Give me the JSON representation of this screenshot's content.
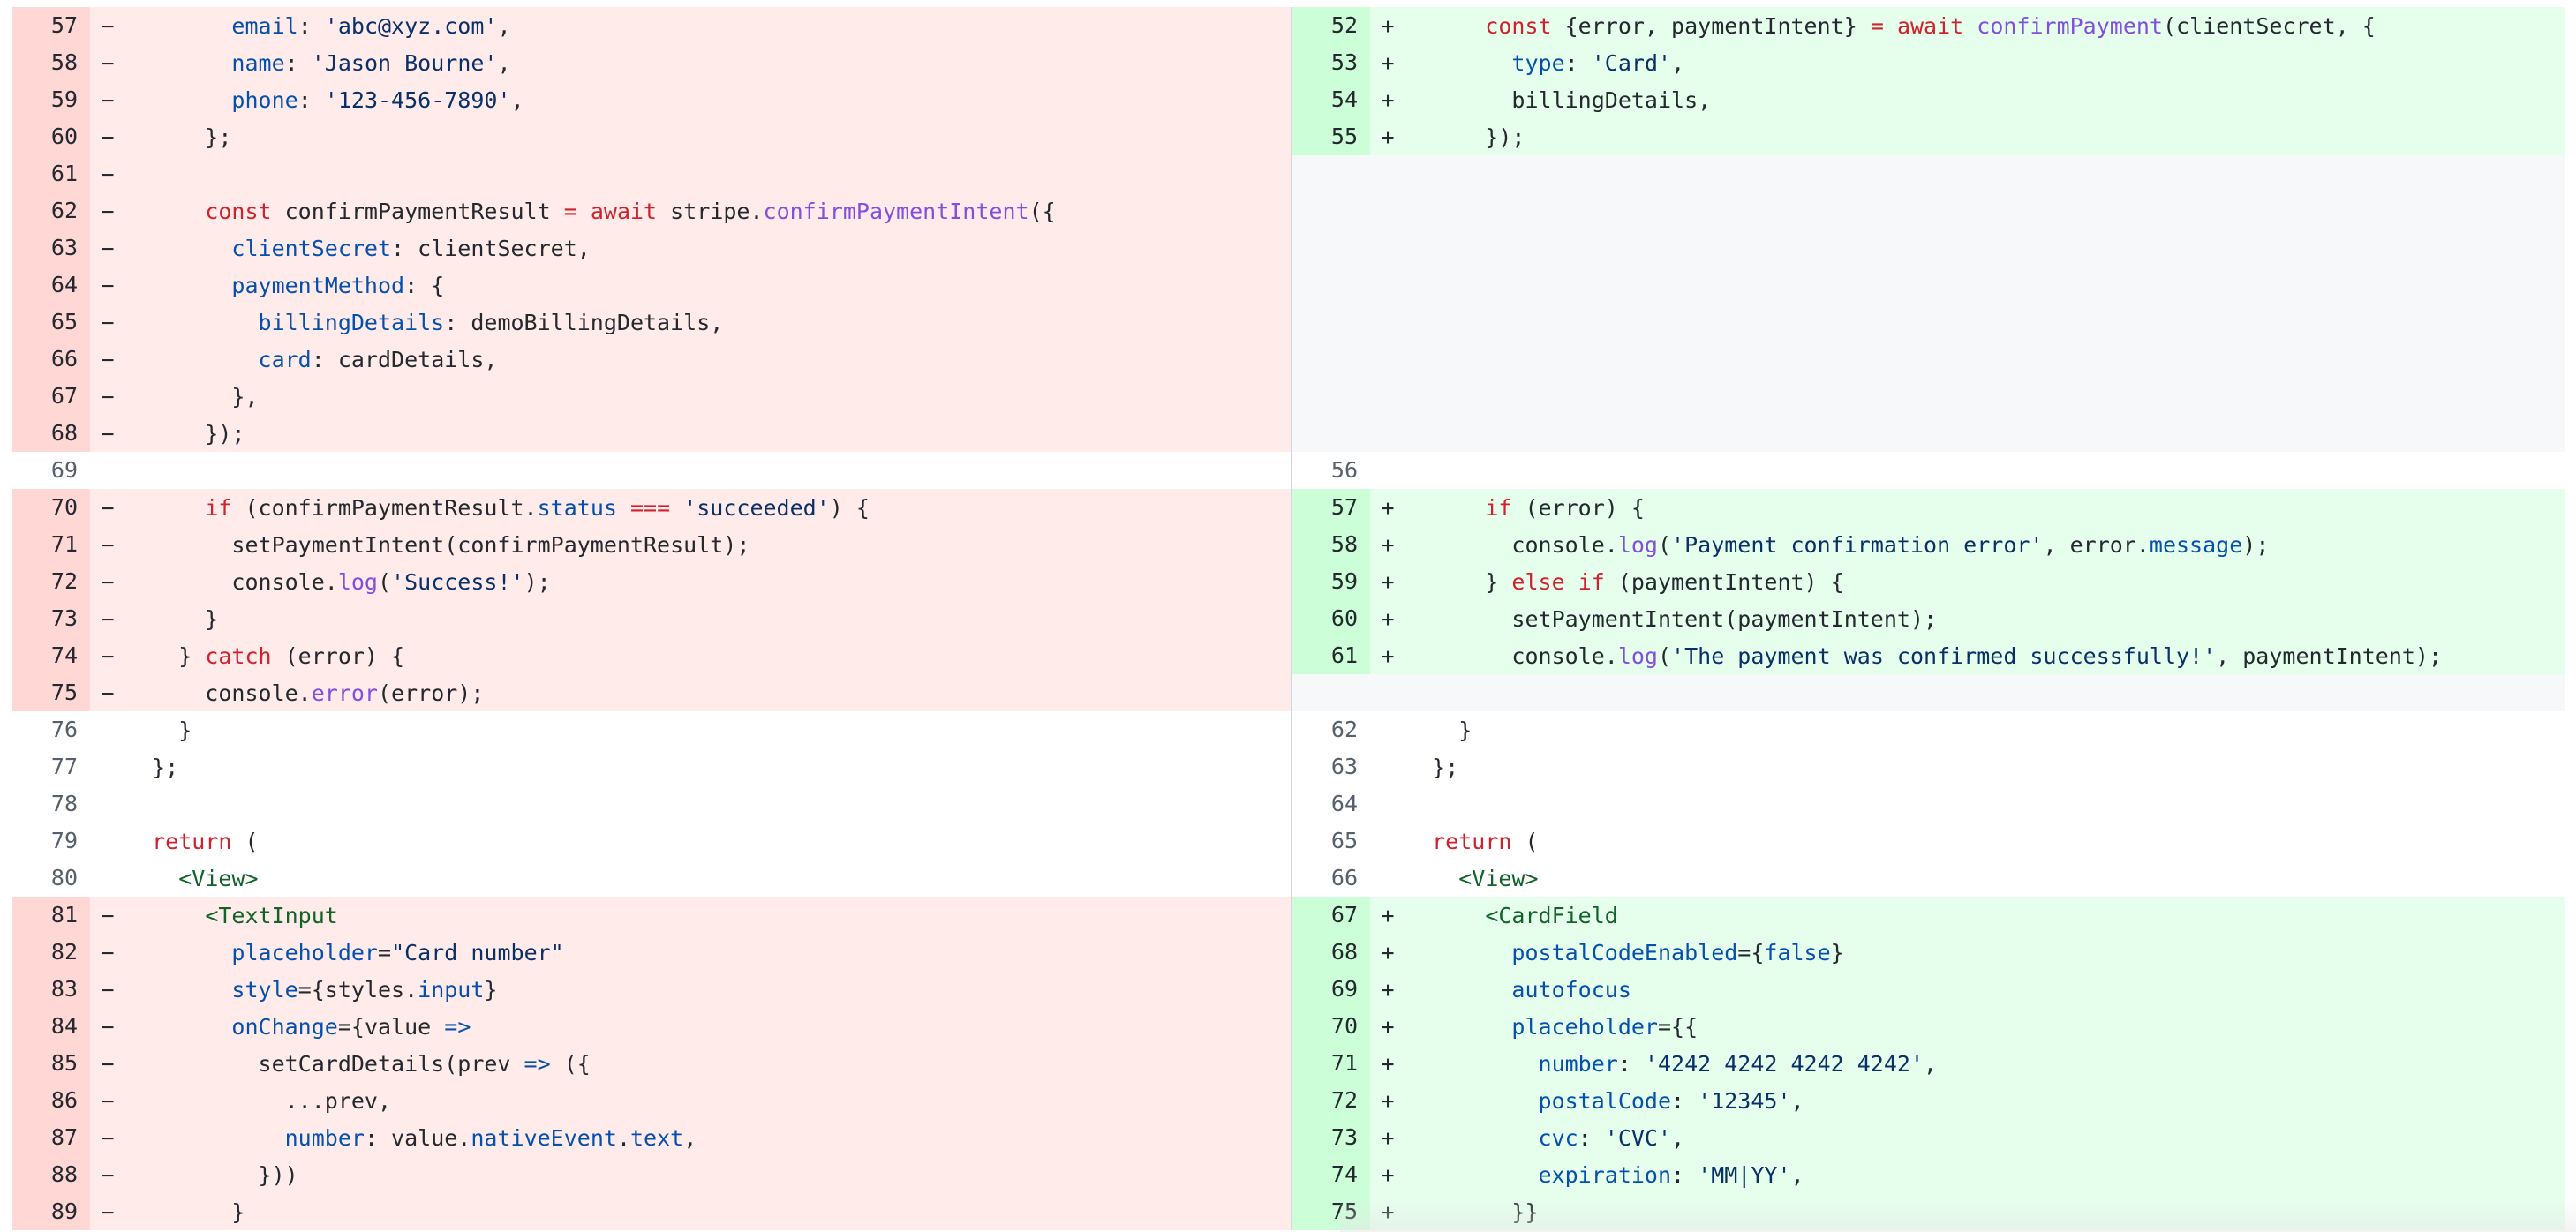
{
  "colors": {
    "del_num_bg": "#ffd7d5",
    "del_code_bg": "#ffebe9",
    "add_num_bg": "#ccffd8",
    "add_code_bg": "#e6ffec",
    "empty_bg": "#f6f8fa",
    "keyword": "#cf222e",
    "property": "#0550ae",
    "string": "#0a3069",
    "function": "#8250df",
    "tag": "#116329"
  },
  "left": [
    {
      "type": "del",
      "num": "57",
      "marker": "−",
      "tokens": [
        [
          "p",
          "        "
        ],
        [
          "prop",
          "email"
        ],
        [
          "p",
          ": "
        ],
        [
          "str",
          "'abc@xyz.com'"
        ],
        [
          "p",
          ","
        ]
      ]
    },
    {
      "type": "del",
      "num": "58",
      "marker": "−",
      "tokens": [
        [
          "p",
          "        "
        ],
        [
          "prop",
          "name"
        ],
        [
          "p",
          ": "
        ],
        [
          "str",
          "'Jason Bourne'"
        ],
        [
          "p",
          ","
        ]
      ]
    },
    {
      "type": "del",
      "num": "59",
      "marker": "−",
      "tokens": [
        [
          "p",
          "        "
        ],
        [
          "prop",
          "phone"
        ],
        [
          "p",
          ": "
        ],
        [
          "str",
          "'123-456-7890'"
        ],
        [
          "p",
          ","
        ]
      ]
    },
    {
      "type": "del",
      "num": "60",
      "marker": "−",
      "tokens": [
        [
          "p",
          "      };"
        ]
      ]
    },
    {
      "type": "del",
      "num": "61",
      "marker": "−",
      "tokens": []
    },
    {
      "type": "del",
      "num": "62",
      "marker": "−",
      "tokens": [
        [
          "p",
          "      "
        ],
        [
          "kw",
          "const"
        ],
        [
          "p",
          " confirmPaymentResult "
        ],
        [
          "kw",
          "="
        ],
        [
          "p",
          " "
        ],
        [
          "kw",
          "await"
        ],
        [
          "p",
          " stripe."
        ],
        [
          "fn",
          "confirmPaymentIntent"
        ],
        [
          "p",
          "({"
        ]
      ]
    },
    {
      "type": "del",
      "num": "63",
      "marker": "−",
      "tokens": [
        [
          "p",
          "        "
        ],
        [
          "prop",
          "clientSecret"
        ],
        [
          "p",
          ": clientSecret,"
        ]
      ]
    },
    {
      "type": "del",
      "num": "64",
      "marker": "−",
      "tokens": [
        [
          "p",
          "        "
        ],
        [
          "prop",
          "paymentMethod"
        ],
        [
          "p",
          ": {"
        ]
      ]
    },
    {
      "type": "del",
      "num": "65",
      "marker": "−",
      "tokens": [
        [
          "p",
          "          "
        ],
        [
          "prop",
          "billingDetails"
        ],
        [
          "p",
          ": demoBillingDetails,"
        ]
      ]
    },
    {
      "type": "del",
      "num": "66",
      "marker": "−",
      "tokens": [
        [
          "p",
          "          "
        ],
        [
          "prop",
          "card"
        ],
        [
          "p",
          ": cardDetails,"
        ]
      ]
    },
    {
      "type": "del",
      "num": "67",
      "marker": "−",
      "tokens": [
        [
          "p",
          "        },"
        ]
      ]
    },
    {
      "type": "del",
      "num": "68",
      "marker": "−",
      "tokens": [
        [
          "p",
          "      });"
        ]
      ]
    },
    {
      "type": "ctx",
      "num": "69",
      "marker": "",
      "tokens": []
    },
    {
      "type": "del",
      "num": "70",
      "marker": "−",
      "tokens": [
        [
          "p",
          "      "
        ],
        [
          "kw",
          "if"
        ],
        [
          "p",
          " (confirmPaymentResult."
        ],
        [
          "prop",
          "status"
        ],
        [
          "p",
          " "
        ],
        [
          "kw",
          "==="
        ],
        [
          "p",
          " "
        ],
        [
          "str",
          "'succeeded'"
        ],
        [
          "p",
          ") {"
        ]
      ]
    },
    {
      "type": "del",
      "num": "71",
      "marker": "−",
      "tokens": [
        [
          "p",
          "        setPaymentIntent(confirmPaymentResult);"
        ]
      ]
    },
    {
      "type": "del",
      "num": "72",
      "marker": "−",
      "tokens": [
        [
          "p",
          "        console."
        ],
        [
          "fn",
          "log"
        ],
        [
          "p",
          "("
        ],
        [
          "str",
          "'Success!'"
        ],
        [
          "p",
          ");"
        ]
      ]
    },
    {
      "type": "del",
      "num": "73",
      "marker": "−",
      "tokens": [
        [
          "p",
          "      }"
        ]
      ]
    },
    {
      "type": "del",
      "num": "74",
      "marker": "−",
      "tokens": [
        [
          "p",
          "    } "
        ],
        [
          "kw",
          "catch"
        ],
        [
          "p",
          " (error) {"
        ]
      ]
    },
    {
      "type": "del",
      "num": "75",
      "marker": "−",
      "tokens": [
        [
          "p",
          "      console."
        ],
        [
          "fn",
          "error"
        ],
        [
          "p",
          "(error);"
        ]
      ]
    },
    {
      "type": "ctx",
      "num": "76",
      "marker": "",
      "tokens": [
        [
          "p",
          "    }"
        ]
      ]
    },
    {
      "type": "ctx",
      "num": "77",
      "marker": "",
      "tokens": [
        [
          "p",
          "  };"
        ]
      ]
    },
    {
      "type": "ctx",
      "num": "78",
      "marker": "",
      "tokens": []
    },
    {
      "type": "ctx",
      "num": "79",
      "marker": "",
      "tokens": [
        [
          "p",
          "  "
        ],
        [
          "kw",
          "return"
        ],
        [
          "p",
          " ("
        ]
      ]
    },
    {
      "type": "ctx",
      "num": "80",
      "marker": "",
      "tokens": [
        [
          "p",
          "    "
        ],
        [
          "tag",
          "<View>"
        ]
      ]
    },
    {
      "type": "del",
      "num": "81",
      "marker": "−",
      "tokens": [
        [
          "p",
          "      "
        ],
        [
          "tag",
          "<TextInput"
        ]
      ]
    },
    {
      "type": "del",
      "num": "82",
      "marker": "−",
      "tokens": [
        [
          "p",
          "        "
        ],
        [
          "prop",
          "placeholder"
        ],
        [
          "p",
          "="
        ],
        [
          "str",
          "\"Card number\""
        ]
      ]
    },
    {
      "type": "del",
      "num": "83",
      "marker": "−",
      "tokens": [
        [
          "p",
          "        "
        ],
        [
          "prop",
          "style"
        ],
        [
          "p",
          "={styles."
        ],
        [
          "prop",
          "input"
        ],
        [
          "p",
          "}"
        ]
      ]
    },
    {
      "type": "del",
      "num": "84",
      "marker": "−",
      "tokens": [
        [
          "p",
          "        "
        ],
        [
          "prop",
          "onChange"
        ],
        [
          "p",
          "={value "
        ],
        [
          "prop",
          "=>"
        ]
      ]
    },
    {
      "type": "del",
      "num": "85",
      "marker": "−",
      "tokens": [
        [
          "p",
          "          setCardDetails(prev "
        ],
        [
          "prop",
          "=>"
        ],
        [
          "p",
          " ({"
        ]
      ]
    },
    {
      "type": "del",
      "num": "86",
      "marker": "−",
      "tokens": [
        [
          "p",
          "            ...prev,"
        ]
      ]
    },
    {
      "type": "del",
      "num": "87",
      "marker": "−",
      "tokens": [
        [
          "p",
          "            "
        ],
        [
          "prop",
          "number"
        ],
        [
          "p",
          ": value."
        ],
        [
          "prop",
          "nativeEvent"
        ],
        [
          "p",
          "."
        ],
        [
          "prop",
          "text"
        ],
        [
          "p",
          ","
        ]
      ]
    },
    {
      "type": "del",
      "num": "88",
      "marker": "−",
      "tokens": [
        [
          "p",
          "          }))"
        ]
      ]
    },
    {
      "type": "del",
      "num": "89",
      "marker": "−",
      "tokens": [
        [
          "p",
          "        }"
        ]
      ]
    }
  ],
  "right": [
    {
      "type": "add",
      "num": "52",
      "marker": "+",
      "tokens": [
        [
          "p",
          "      "
        ],
        [
          "kw",
          "const"
        ],
        [
          "p",
          " {error, paymentIntent} "
        ],
        [
          "kw",
          "="
        ],
        [
          "p",
          " "
        ],
        [
          "kw",
          "await"
        ],
        [
          "p",
          " "
        ],
        [
          "fn",
          "confirmPayment"
        ],
        [
          "p",
          "(clientSecret, {"
        ]
      ]
    },
    {
      "type": "add",
      "num": "53",
      "marker": "+",
      "tokens": [
        [
          "p",
          "        "
        ],
        [
          "prop",
          "type"
        ],
        [
          "p",
          ": "
        ],
        [
          "str",
          "'Card'"
        ],
        [
          "p",
          ","
        ]
      ]
    },
    {
      "type": "add",
      "num": "54",
      "marker": "+",
      "tokens": [
        [
          "p",
          "        billingDetails,"
        ]
      ]
    },
    {
      "type": "add",
      "num": "55",
      "marker": "+",
      "tokens": [
        [
          "p",
          "      });"
        ]
      ]
    },
    {
      "type": "empty",
      "num": "",
      "marker": "",
      "tokens": []
    },
    {
      "type": "empty",
      "num": "",
      "marker": "",
      "tokens": []
    },
    {
      "type": "empty",
      "num": "",
      "marker": "",
      "tokens": []
    },
    {
      "type": "empty",
      "num": "",
      "marker": "",
      "tokens": []
    },
    {
      "type": "empty",
      "num": "",
      "marker": "",
      "tokens": []
    },
    {
      "type": "empty",
      "num": "",
      "marker": "",
      "tokens": []
    },
    {
      "type": "empty",
      "num": "",
      "marker": "",
      "tokens": []
    },
    {
      "type": "empty",
      "num": "",
      "marker": "",
      "tokens": []
    },
    {
      "type": "ctx",
      "num": "56",
      "marker": "",
      "tokens": []
    },
    {
      "type": "add",
      "num": "57",
      "marker": "+",
      "tokens": [
        [
          "p",
          "      "
        ],
        [
          "kw",
          "if"
        ],
        [
          "p",
          " (error) {"
        ]
      ]
    },
    {
      "type": "add",
      "num": "58",
      "marker": "+",
      "tokens": [
        [
          "p",
          "        console."
        ],
        [
          "fn",
          "log"
        ],
        [
          "p",
          "("
        ],
        [
          "str",
          "'Payment confirmation error'"
        ],
        [
          "p",
          ", error."
        ],
        [
          "prop",
          "message"
        ],
        [
          "p",
          ");"
        ]
      ]
    },
    {
      "type": "add",
      "num": "59",
      "marker": "+",
      "tokens": [
        [
          "p",
          "      } "
        ],
        [
          "kw",
          "else if"
        ],
        [
          "p",
          " (paymentIntent) {"
        ]
      ]
    },
    {
      "type": "add",
      "num": "60",
      "marker": "+",
      "tokens": [
        [
          "p",
          "        setPaymentIntent(paymentIntent);"
        ]
      ]
    },
    {
      "type": "add",
      "num": "61",
      "marker": "+",
      "tokens": [
        [
          "p",
          "        console."
        ],
        [
          "fn",
          "log"
        ],
        [
          "p",
          "("
        ],
        [
          "str",
          "'The payment was confirmed successfully!'"
        ],
        [
          "p",
          ", paymentIntent);"
        ]
      ]
    },
    {
      "type": "empty",
      "num": "",
      "marker": "",
      "tokens": []
    },
    {
      "type": "ctx",
      "num": "62",
      "marker": "",
      "tokens": [
        [
          "p",
          "    }"
        ]
      ]
    },
    {
      "type": "ctx",
      "num": "63",
      "marker": "",
      "tokens": [
        [
          "p",
          "  };"
        ]
      ]
    },
    {
      "type": "ctx",
      "num": "64",
      "marker": "",
      "tokens": []
    },
    {
      "type": "ctx",
      "num": "65",
      "marker": "",
      "tokens": [
        [
          "p",
          "  "
        ],
        [
          "kw",
          "return"
        ],
        [
          "p",
          " ("
        ]
      ]
    },
    {
      "type": "ctx",
      "num": "66",
      "marker": "",
      "tokens": [
        [
          "p",
          "    "
        ],
        [
          "tag",
          "<View>"
        ]
      ]
    },
    {
      "type": "add",
      "num": "67",
      "marker": "+",
      "tokens": [
        [
          "p",
          "      "
        ],
        [
          "tag",
          "<CardField"
        ]
      ]
    },
    {
      "type": "add",
      "num": "68",
      "marker": "+",
      "tokens": [
        [
          "p",
          "        "
        ],
        [
          "prop",
          "postalCodeEnabled"
        ],
        [
          "p",
          "={"
        ],
        [
          "prop",
          "false"
        ],
        [
          "p",
          "}"
        ]
      ]
    },
    {
      "type": "add",
      "num": "69",
      "marker": "+",
      "tokens": [
        [
          "p",
          "        "
        ],
        [
          "prop",
          "autofocus"
        ]
      ]
    },
    {
      "type": "add",
      "num": "70",
      "marker": "+",
      "tokens": [
        [
          "p",
          "        "
        ],
        [
          "prop",
          "placeholder"
        ],
        [
          "p",
          "={{"
        ]
      ]
    },
    {
      "type": "add",
      "num": "71",
      "marker": "+",
      "tokens": [
        [
          "p",
          "          "
        ],
        [
          "prop",
          "number"
        ],
        [
          "p",
          ": "
        ],
        [
          "str",
          "'4242 4242 4242 4242'"
        ],
        [
          "p",
          ","
        ]
      ]
    },
    {
      "type": "add",
      "num": "72",
      "marker": "+",
      "tokens": [
        [
          "p",
          "          "
        ],
        [
          "prop",
          "postalCode"
        ],
        [
          "p",
          ": "
        ],
        [
          "str",
          "'12345'"
        ],
        [
          "p",
          ","
        ]
      ]
    },
    {
      "type": "add",
      "num": "73",
      "marker": "+",
      "tokens": [
        [
          "p",
          "          "
        ],
        [
          "prop",
          "cvc"
        ],
        [
          "p",
          ": "
        ],
        [
          "str",
          "'CVC'"
        ],
        [
          "p",
          ","
        ]
      ]
    },
    {
      "type": "add",
      "num": "74",
      "marker": "+",
      "tokens": [
        [
          "p",
          "          "
        ],
        [
          "prop",
          "expiration"
        ],
        [
          "p",
          ": "
        ],
        [
          "str",
          "'MM|YY'"
        ],
        [
          "p",
          ","
        ]
      ]
    },
    {
      "type": "add",
      "num": "75",
      "marker": "+",
      "tokens": [
        [
          "p",
          "        }}"
        ]
      ]
    }
  ]
}
